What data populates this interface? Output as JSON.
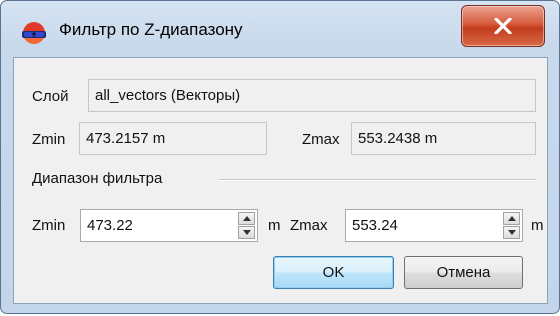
{
  "window": {
    "title": "Фильтр по Z-диапазону",
    "icon": "colored-glasses-icon",
    "close_icon": "close-x-icon",
    "accent": "#c8d9ec",
    "close_color": "#c94a2b"
  },
  "layer": {
    "label": "Слой",
    "value": "all_vectors (Векторы)"
  },
  "current": {
    "zmin_label": "Zmin",
    "zmin_value": "473.2157 m",
    "zmax_label": "Zmax",
    "zmax_value": "553.2438 m"
  },
  "filter": {
    "group_label": "Диапазон фильтра",
    "zmin_label": "Zmin",
    "zmin_value": "473.22",
    "zmin_unit": "m",
    "zmax_label": "Zmax",
    "zmax_value": "553.24",
    "zmax_unit": "m"
  },
  "buttons": {
    "ok": "OK",
    "cancel": "Отмена"
  }
}
